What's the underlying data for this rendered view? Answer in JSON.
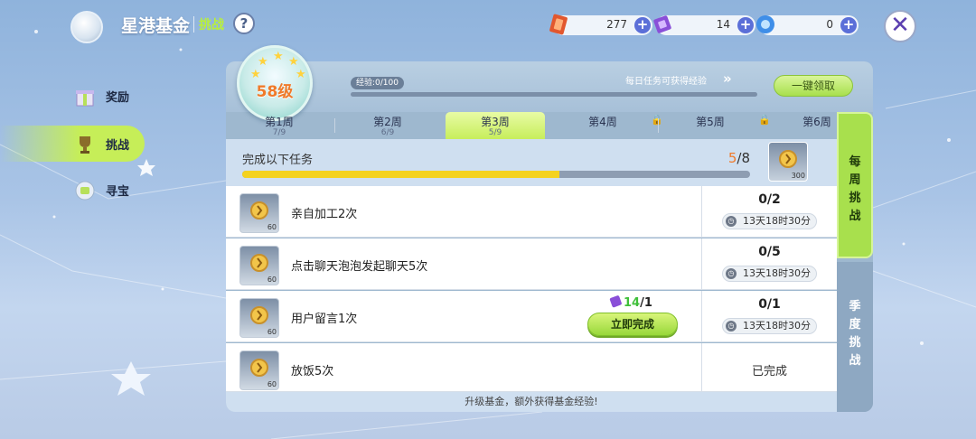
{
  "header": {
    "title": "星港基金",
    "subtitle": "挑战",
    "help": "?",
    "close": "✕",
    "currencies": [
      {
        "icon": "red-ticket-icon",
        "value": "277",
        "color": "#e2572e"
      },
      {
        "icon": "purple-gem-icon",
        "value": "14",
        "color": "#8a4fd8"
      },
      {
        "icon": "blue-crystal-icon",
        "value": "0",
        "color": "#3f8ee8"
      }
    ],
    "plus": "+"
  },
  "nav": {
    "items": [
      {
        "label": "奖励",
        "icon": "gift-icon"
      },
      {
        "label": "挑战",
        "icon": "trophy-icon",
        "active": true
      },
      {
        "label": "寻宝",
        "icon": "treasure-icon"
      }
    ]
  },
  "level": {
    "label": "58级",
    "exp": "经验:0/100",
    "exp_fraction": 0.0,
    "daily_text": "每日任务可获得经验",
    "claim_label": "一键领取"
  },
  "weeks": [
    {
      "name": "第1周",
      "progress": "7/9",
      "locked": false
    },
    {
      "name": "第2周",
      "progress": "6/9",
      "locked": false
    },
    {
      "name": "第3周",
      "progress": "5/9",
      "locked": false,
      "active": true
    },
    {
      "name": "第4周",
      "progress": "",
      "locked": true
    },
    {
      "name": "第5周",
      "progress": "",
      "locked": true
    },
    {
      "name": "第6周",
      "progress": "",
      "locked": false
    }
  ],
  "task_header": {
    "title": "完成以下任务",
    "done": "5",
    "total": "/8",
    "progress_fraction": 0.625,
    "reward_amount": "300"
  },
  "tasks": [
    {
      "name": "亲自加工2次",
      "reward": "60",
      "count": "0/2",
      "time": "13天18时30分",
      "status": ""
    },
    {
      "name": "点击聊天泡泡发起聊天5次",
      "reward": "60",
      "count": "0/5",
      "time": "13天18时30分",
      "status": ""
    },
    {
      "name": "用户留言1次",
      "reward": "60",
      "count": "0/1",
      "time": "13天18时30分",
      "status": "",
      "gem_have": "14",
      "gem_need": "/1",
      "finish_label": "立即完成"
    },
    {
      "name": "放饭5次",
      "reward": "60",
      "count": "",
      "time": "",
      "status": "已完成"
    }
  ],
  "footer": "升级基金，额外获得基金经验!",
  "side_tabs": {
    "weekly": "每\n周\n挑\n战",
    "seasonal": "季\n度\n挑\n战"
  }
}
